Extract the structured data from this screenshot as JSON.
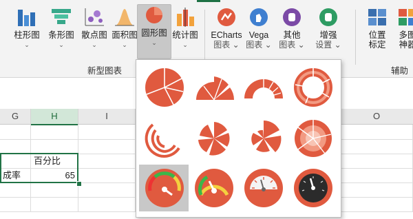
{
  "ribbon": {
    "buttons": [
      {
        "line1": "柱形图",
        "line2": "⌄"
      },
      {
        "line1": "条形图",
        "line2": "⌄"
      },
      {
        "line1": "散点图",
        "line2": "⌄"
      },
      {
        "line1": "面积图",
        "line2": "⌄"
      },
      {
        "line1": "圆形图",
        "line2": "⌄"
      },
      {
        "line1": "统计图",
        "line2": "⌄"
      },
      {
        "line1": "ECharts",
        "line2": "图表 ⌄"
      },
      {
        "line1": "Vega",
        "line2": "图表 ⌄"
      },
      {
        "line1": "其他",
        "line2": "图表 ⌄"
      },
      {
        "line1": "增强",
        "line2": "设置 ⌄"
      },
      {
        "line1": "位置",
        "line2": "标定"
      },
      {
        "line1": "多图",
        "line2": "神器"
      }
    ],
    "group_label_new": "新型图表",
    "group_label_aux": "辅助"
  },
  "sheet": {
    "columns": [
      "G",
      "H",
      "I",
      "O"
    ],
    "header_cell": "百分比",
    "row_label": "成率",
    "row_value": "65"
  },
  "gallery": {
    "items": [
      {
        "icon": "pie-segmented-icon"
      },
      {
        "icon": "fan-pie-icon"
      },
      {
        "icon": "half-donut-icon"
      },
      {
        "icon": "segmented-ring-icon"
      },
      {
        "icon": "radial-bars-icon"
      },
      {
        "icon": "rose-pie-icon"
      },
      {
        "icon": "nightingale-pie-icon"
      },
      {
        "icon": "layered-rose-icon"
      },
      {
        "icon": "gauge-color-bands-icon"
      },
      {
        "icon": "gauge-gradient-icon"
      },
      {
        "icon": "gauge-ticks-icon"
      },
      {
        "icon": "gauge-dark-icon"
      }
    ]
  },
  "colors": {
    "accent": "#e05a3f",
    "excel_green": "#217346",
    "dark": "#2b2b2b"
  }
}
